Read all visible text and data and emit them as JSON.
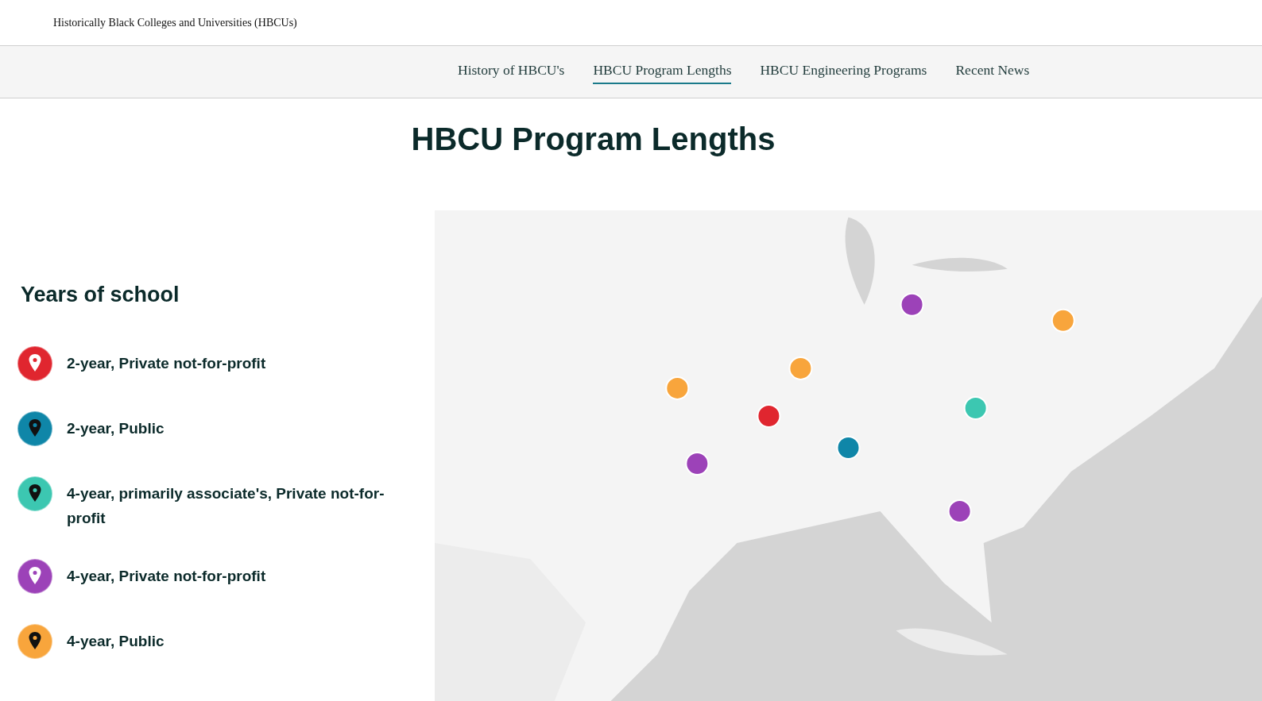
{
  "site_title": "Historically Black Colleges and Universities (HBCUs)",
  "nav": [
    {
      "label": "History of HBCU's",
      "selected": false
    },
    {
      "label": "HBCU Program Lengths",
      "selected": true
    },
    {
      "label": "HBCU Engineering Programs",
      "selected": false
    },
    {
      "label": "Recent News",
      "selected": false
    }
  ],
  "page_title": "HBCU Program Lengths",
  "legend": {
    "title": "Years of school",
    "items": [
      {
        "label": "2-year, Private not-for-profit",
        "color": "#e0262f",
        "light_pin": true
      },
      {
        "label": "2-year, Public",
        "color": "#0f86a8",
        "light_pin": false
      },
      {
        "label": "4-year, primarily associate's, Private not-for-profit",
        "color": "#3cc7b1",
        "light_pin": false
      },
      {
        "label": "4-year, Private not-for-profit",
        "color": "#9c42b8",
        "light_pin": true
      },
      {
        "label": "4-year, Public",
        "color": "#f8a53c",
        "light_pin": false
      }
    ]
  }
}
